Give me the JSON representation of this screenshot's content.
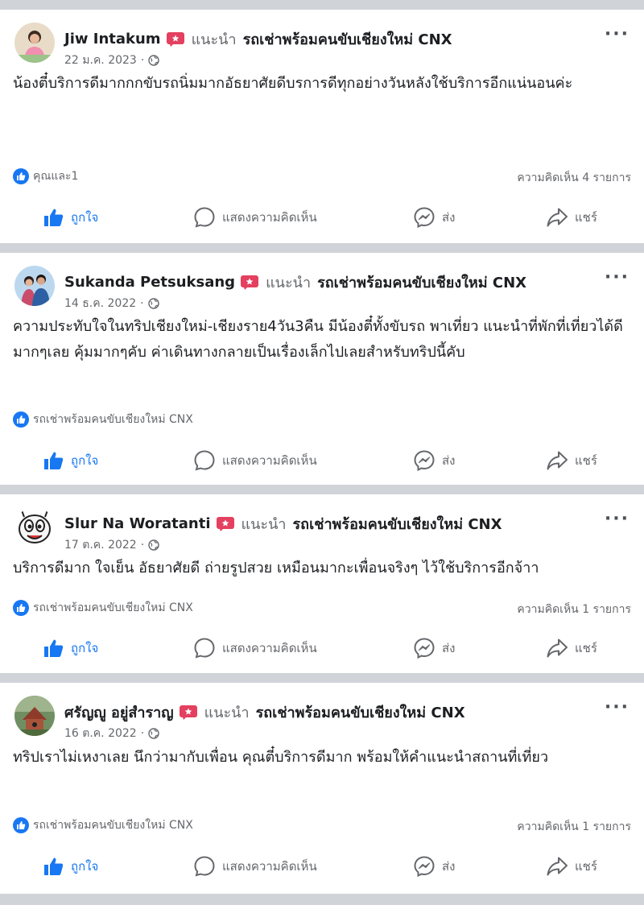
{
  "posts": [
    {
      "author": "Jiw Intakum",
      "recommends": "แนะนำ",
      "page": "รถเช่าพร้อมคนขับเชียงใหม่ CNX",
      "date": "22 ม.ค. 2023",
      "text": "น้องตี๋บริการดีมากกกขับรถนิ่มมากอัธยาศัยดีบรการดีทุกอย่างวันหลังใช้บริการอีกแน่นอนค่ะ",
      "reactions": "คุณและ1",
      "comments": "ความคิดเห็น 4 รายการ"
    },
    {
      "author": "Sukanda Petsuksang",
      "recommends": "แนะนำ",
      "page": "รถเช่าพร้อมคนขับเชียงใหม่ CNX",
      "date": "14 ธ.ค. 2022",
      "text": "ความประทับใจในทริปเชียงใหม่-เชียงราย4วัน3คืน มีน้องตี๋ทั้งขับรถ พาเที่ยว แนะนำที่พักที่เที่ยวได้ดีมากๆเลย คุ้มมากๆคับ ค่าเดินทางกลายเป็นเรื่องเล็กไปเลยสำหรับทริปนี้คับ",
      "reactions": "รถเช่าพร้อมคนขับเชียงใหม่ CNX",
      "comments": ""
    },
    {
      "author": "Slur Na Woratanti",
      "recommends": "แนะนำ",
      "page": "รถเช่าพร้อมคนขับเชียงใหม่ CNX",
      "date": "17 ต.ค. 2022",
      "text": "บริการดีมาก ใจเย็น อัธยาศัยดี ถ่ายรูปสวย เหมือนมากะเพื่อนจริงๆ ไว้ใช้บริการอีกจ้าา",
      "reactions": "รถเช่าพร้อมคนขับเชียงใหม่ CNX",
      "comments": "ความคิดเห็น 1 รายการ"
    },
    {
      "author": "ศรัญญู อยู่สำราญ",
      "recommends": "แนะนำ",
      "page": "รถเช่าพร้อมคนขับเชียงใหม่ CNX",
      "date": "16 ต.ค. 2022",
      "text": "ทริปเราไม่เหงาเลย นึกว่ามากับเพื่อน คุณตี๋บริการดีมาก พร้อมให้คำแนะนำสถานที่เที่ยว",
      "reactions": "รถเช่าพร้อมคนขับเชียงใหม่ CNX",
      "comments": "ความคิดเห็น 1 รายการ"
    }
  ],
  "actions": {
    "like": "ถูกใจ",
    "comment": "แสดงความคิดเห็น",
    "send": "ส่ง",
    "share": "แชร์"
  },
  "date_separator": "·",
  "more": "···",
  "colors": {
    "accent": "#1877f2",
    "badge": "#e4405f",
    "divider": "#d0d3d7"
  }
}
